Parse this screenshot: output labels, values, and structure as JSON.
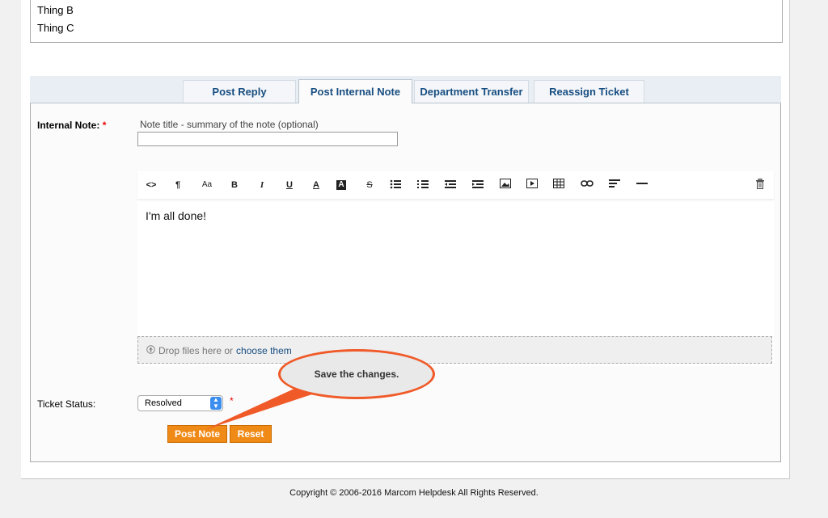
{
  "thread": {
    "items": [
      "Thing B",
      "Thing C"
    ]
  },
  "tabs": [
    {
      "label": "Post Reply",
      "active": false
    },
    {
      "label": "Post Internal Note",
      "active": true
    },
    {
      "label": "Department Transfer",
      "active": false
    },
    {
      "label": "Reassign Ticket",
      "active": false
    }
  ],
  "form": {
    "internal_note_label": "Internal Note:",
    "required_mark": "*",
    "title_hint": "Note title - summary of the note (optional)",
    "title_value": "",
    "editor_text": "I'm all done!",
    "toolbar": {
      "html": "<>",
      "paragraph": "¶",
      "formatting": "Aa",
      "bold": "B",
      "italic": "I",
      "underline": "U",
      "font_color": "A",
      "background_color": "A",
      "strikethrough": "S"
    },
    "dropzone_text": "Drop files here or",
    "dropzone_link": "choose them",
    "status_label": "Ticket Status:",
    "status_value": "Resolved",
    "post_button": "Post Note",
    "reset_button": "Reset"
  },
  "annotation": {
    "callout_text": "Save the changes.",
    "color": "#f05a28"
  },
  "colors": {
    "accent_button": "#f08a17",
    "tab_text": "#184e81"
  },
  "footer": {
    "copyright": "Copyright © 2006-2016 Marcom Helpdesk All Rights Reserved."
  }
}
